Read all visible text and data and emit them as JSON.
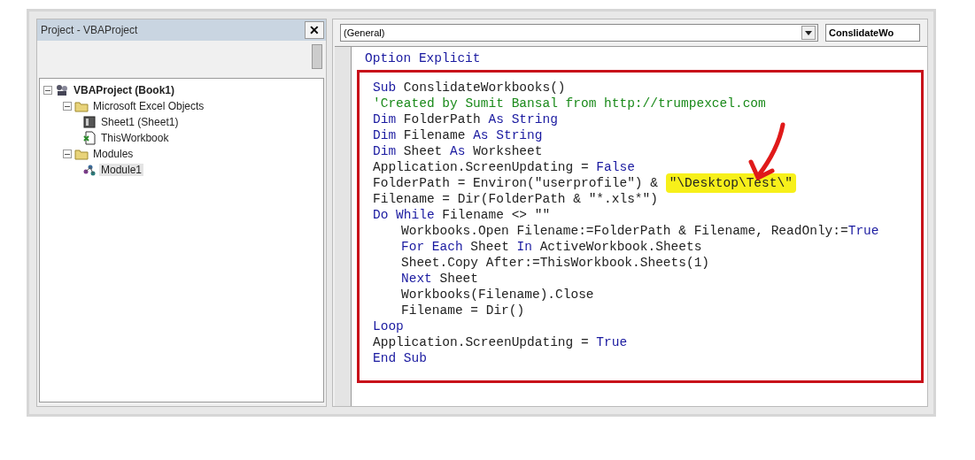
{
  "project_panel": {
    "title": "Project - VBAProject",
    "close": "✕",
    "tree": [
      {
        "label": "VBAProject (Book1)",
        "kind": "project",
        "expanded": true,
        "selected": false,
        "children": [
          {
            "label": "Microsoft Excel Objects",
            "kind": "folder",
            "expanded": true,
            "selected": false,
            "children": [
              {
                "label": "Sheet1 (Sheet1)",
                "kind": "sheet",
                "selected": false
              },
              {
                "label": "ThisWorkbook",
                "kind": "workbook",
                "selected": false
              }
            ]
          },
          {
            "label": "Modules",
            "kind": "folder",
            "expanded": true,
            "selected": false,
            "children": [
              {
                "label": "Module1",
                "kind": "module",
                "selected": true
              }
            ]
          }
        ]
      }
    ]
  },
  "code_window": {
    "object_dropdown": "(General)",
    "procedure_dropdown": "ConslidateWo",
    "lines": [
      {
        "framed": false,
        "indented": false,
        "parts": [
          {
            "kind": "keyword",
            "text": "Option Explicit"
          }
        ]
      },
      {
        "framed": true,
        "indented": false,
        "parts": [
          {
            "kind": "keyword",
            "text": "Sub"
          },
          {
            "kind": "plain",
            "text": " ConslidateWorkbooks()"
          }
        ]
      },
      {
        "framed": true,
        "indented": false,
        "parts": [
          {
            "kind": "comment",
            "text": "'Created by Sumit Bansal from http://trumpexcel.com"
          }
        ]
      },
      {
        "framed": true,
        "indented": false,
        "parts": [
          {
            "kind": "keyword",
            "text": "Dim"
          },
          {
            "kind": "plain",
            "text": " FolderPath "
          },
          {
            "kind": "keyword",
            "text": "As String"
          }
        ]
      },
      {
        "framed": true,
        "indented": false,
        "parts": [
          {
            "kind": "keyword",
            "text": "Dim"
          },
          {
            "kind": "plain",
            "text": " Filename "
          },
          {
            "kind": "keyword",
            "text": "As String"
          }
        ]
      },
      {
        "framed": true,
        "indented": false,
        "parts": [
          {
            "kind": "keyword",
            "text": "Dim"
          },
          {
            "kind": "plain",
            "text": " Sheet "
          },
          {
            "kind": "keyword",
            "text": "As"
          },
          {
            "kind": "plain",
            "text": " Worksheet"
          }
        ]
      },
      {
        "framed": true,
        "indented": false,
        "parts": [
          {
            "kind": "plain",
            "text": "Application.ScreenUpdating = "
          },
          {
            "kind": "keyword",
            "text": "False"
          }
        ]
      },
      {
        "framed": true,
        "indented": false,
        "parts": [
          {
            "kind": "plain",
            "text": "FolderPath = Environ(\"userprofile\") & "
          },
          {
            "kind": "highlight",
            "text": "\"\\Desktop\\Test\\\""
          }
        ]
      },
      {
        "framed": true,
        "indented": false,
        "parts": [
          {
            "kind": "plain",
            "text": "Filename = Dir(FolderPath & \"*.xls*\")"
          }
        ]
      },
      {
        "framed": true,
        "indented": false,
        "parts": [
          {
            "kind": "keyword",
            "text": "Do While"
          },
          {
            "kind": "plain",
            "text": " Filename <> \"\""
          }
        ]
      },
      {
        "framed": true,
        "indented": true,
        "parts": [
          {
            "kind": "plain",
            "text": "Workbooks.Open Filename:=FolderPath & Filename, ReadOnly:="
          },
          {
            "kind": "keyword",
            "text": "True"
          }
        ]
      },
      {
        "framed": true,
        "indented": true,
        "parts": [
          {
            "kind": "keyword",
            "text": "For Each"
          },
          {
            "kind": "plain",
            "text": " Sheet "
          },
          {
            "kind": "keyword",
            "text": "In"
          },
          {
            "kind": "plain",
            "text": " ActiveWorkbook.Sheets"
          }
        ]
      },
      {
        "framed": true,
        "indented": true,
        "parts": [
          {
            "kind": "plain",
            "text": "Sheet.Copy After:=ThisWorkbook.Sheets(1)"
          }
        ]
      },
      {
        "framed": true,
        "indented": true,
        "parts": [
          {
            "kind": "keyword",
            "text": "Next"
          },
          {
            "kind": "plain",
            "text": " Sheet"
          }
        ]
      },
      {
        "framed": true,
        "indented": true,
        "parts": [
          {
            "kind": "plain",
            "text": "Workbooks(Filename).Close"
          }
        ]
      },
      {
        "framed": true,
        "indented": true,
        "parts": [
          {
            "kind": "plain",
            "text": "Filename = Dir()"
          }
        ]
      },
      {
        "framed": true,
        "indented": false,
        "parts": [
          {
            "kind": "keyword",
            "text": "Loop"
          }
        ]
      },
      {
        "framed": true,
        "indented": false,
        "parts": [
          {
            "kind": "plain",
            "text": "Application.ScreenUpdating = "
          },
          {
            "kind": "keyword",
            "text": "True"
          }
        ]
      },
      {
        "framed": true,
        "indented": false,
        "parts": [
          {
            "kind": "keyword",
            "text": "End Sub"
          }
        ]
      }
    ]
  }
}
